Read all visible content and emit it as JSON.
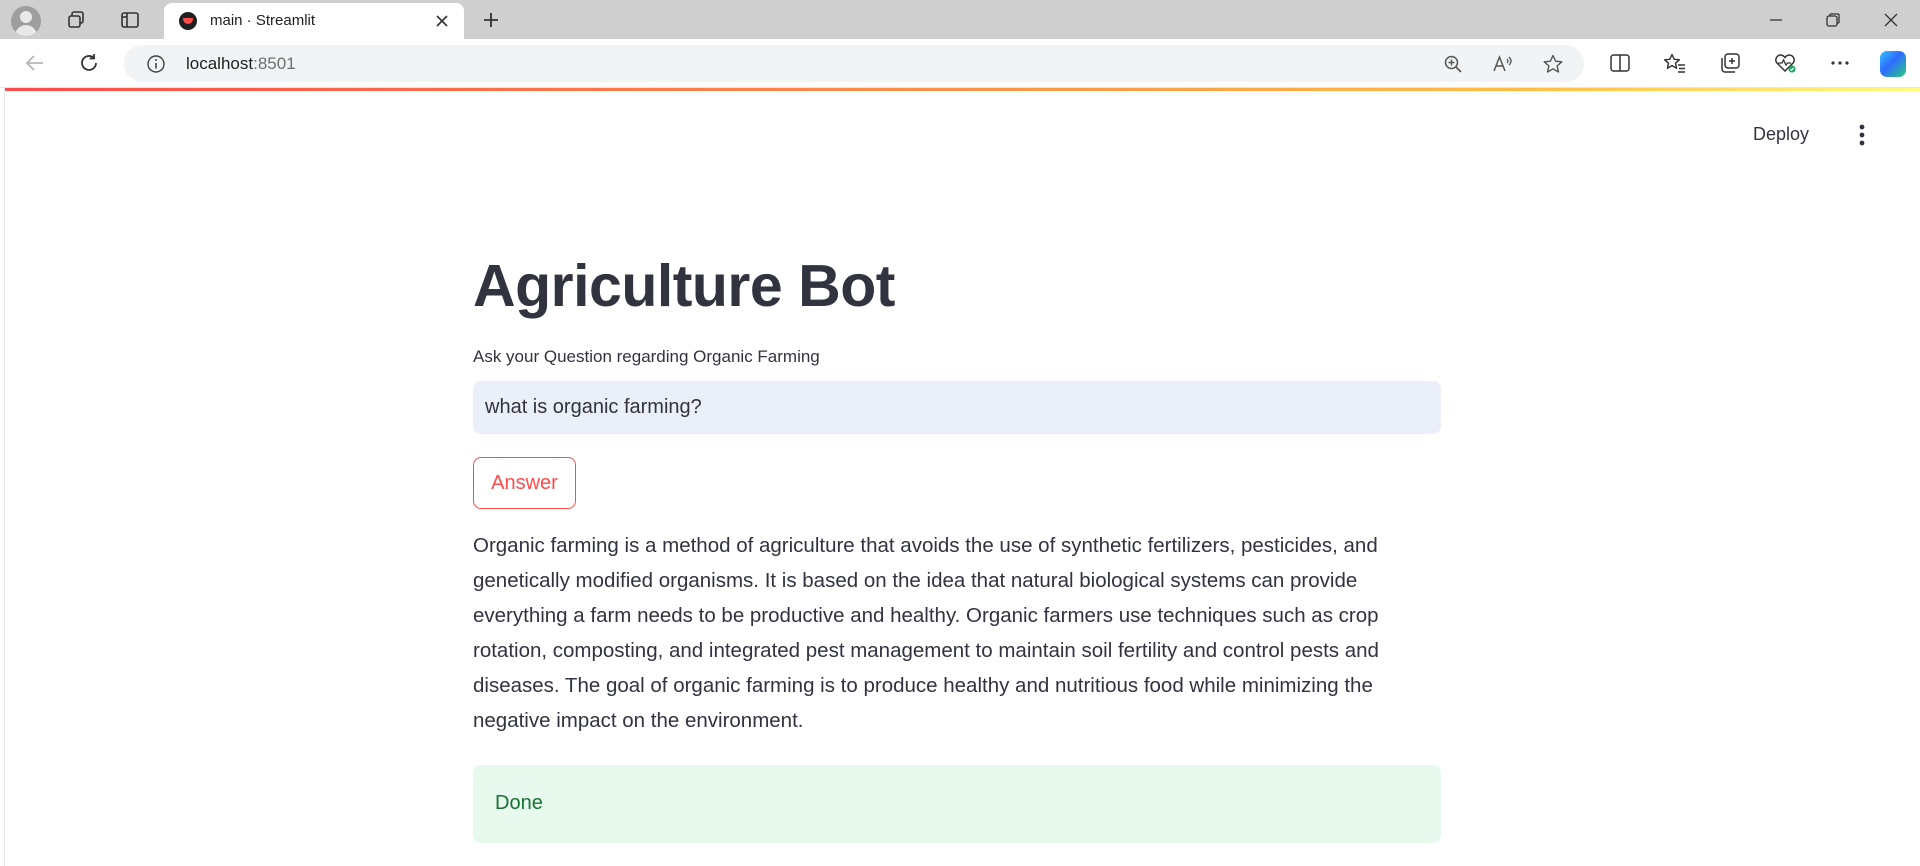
{
  "browser": {
    "tab_title": "main · Streamlit",
    "url_host": "localhost",
    "url_port": ":8501"
  },
  "app": {
    "deploy_label": "Deploy",
    "title": "Agriculture Bot",
    "input_label": "Ask your Question regarding Organic Farming",
    "input_value": "what is organic farming?",
    "answer_button": "Answer",
    "answer_text": "Organic farming is a method of agriculture that avoids the use of synthetic fertilizers, pesticides, and genetically modified organisms. It is based on the idea that natural biological systems can provide everything a farm needs to be productive and healthy. Organic farmers use techniques such as crop rotation, composting, and integrated pest management to maintain soil fertility and control pests and diseases. The goal of organic farming is to produce healthy and nutritious food while minimizing the negative impact on the environment.",
    "status_message": "Done"
  },
  "colors": {
    "primary": "#ff4b4b",
    "text": "#31333f",
    "input_bg": "#eaeff9",
    "success_bg": "#e8f9ee",
    "success_text": "#177233"
  },
  "icons": [
    "profile-icon",
    "workspaces-icon",
    "tab-actions-icon",
    "streamlit-favicon",
    "close-icon",
    "plus-icon",
    "minimize-icon",
    "restore-icon",
    "back-icon",
    "refresh-icon",
    "info-icon",
    "zoom-icon",
    "read-aloud-icon",
    "favorite-icon",
    "split-screen-icon",
    "favorites-icon",
    "collections-icon",
    "browser-essentials-icon",
    "more-icon",
    "copilot-icon",
    "kebab-menu-icon"
  ]
}
